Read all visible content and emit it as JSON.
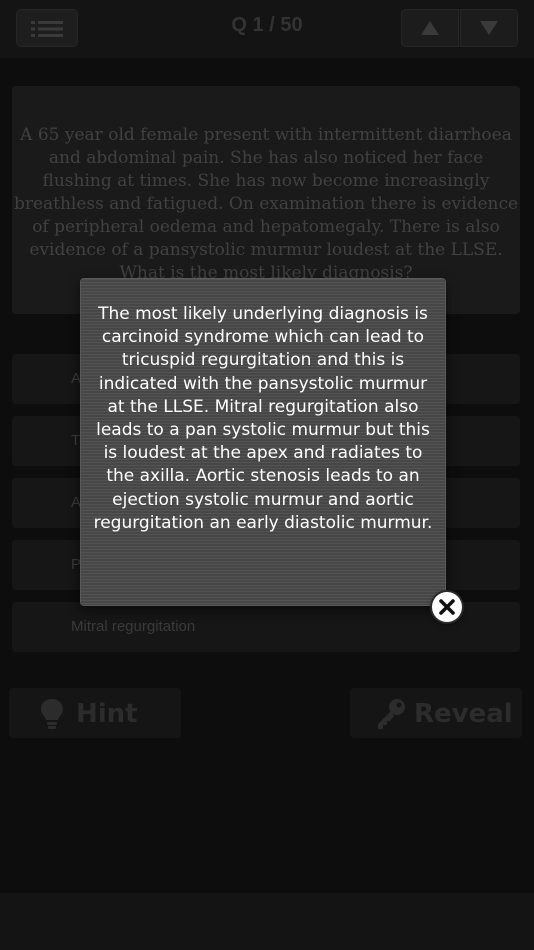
{
  "header": {
    "counter": "Q 1 / 50"
  },
  "question": {
    "text": "A 65 year old female present with intermittent diarrhoea and abdominal pain. She has also noticed her face flushing at times. She has now become increasingly breathless and fatigued. On examination there is evidence of peripheral oedema and hepatomegaly. There is also evidence of a pansystolic murmur loudest at the LLSE. What is the most likely diagnosis?"
  },
  "answers": [
    {
      "label": "A"
    },
    {
      "label": "T"
    },
    {
      "label": "A"
    },
    {
      "label": "P"
    },
    {
      "label": "Mitral regurgitation"
    }
  ],
  "actions": {
    "hint_label": "Hint",
    "reveal_label": "Reveal"
  },
  "explanation": {
    "text": "The most likely underlying diagnosis is carcinoid syndrome which can lead to tricuspid regurgitation and this is indicated with the pansystolic murmur at the LLSE. Mitral regurgitation also leads to a pan systolic murmur but this is loudest at the apex and radiates to the axilla. Aortic stenosis leads to an ejection systolic murmur and aortic regurgitation an early diastolic murmur."
  },
  "icons": {
    "menu": "menu-icon",
    "up": "arrow-up-icon",
    "down": "arrow-down-icon",
    "hint": "lightbulb-icon",
    "reveal": "key-icon",
    "close": "close-icon"
  }
}
